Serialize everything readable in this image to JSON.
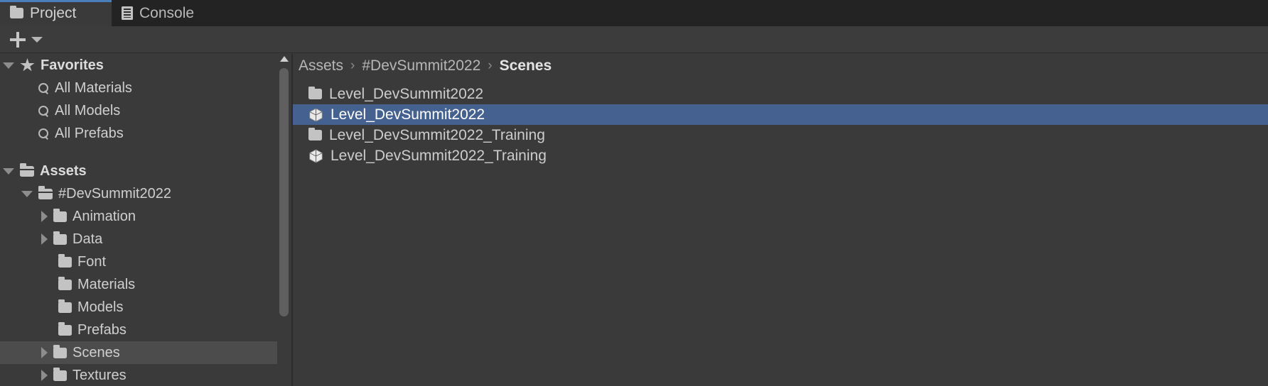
{
  "window": {
    "background": "#3a3a3a",
    "accent_blue": "#4a7ebb",
    "selection_blue": "#44618f",
    "row_highlight": "#4c4c4c"
  },
  "tabs": [
    {
      "label": "Project",
      "icon": "folder-icon",
      "active": true
    },
    {
      "label": "Console",
      "icon": "console-icon",
      "active": false
    }
  ],
  "toolbar": {
    "add_label": "+",
    "add_icon": "plus-icon",
    "dropdown_icon": "caret-down-icon",
    "search": {
      "icon": "search-icon",
      "value": "",
      "placeholder": ""
    }
  },
  "sidebar": {
    "sections": [
      {
        "name": "favorites",
        "header": {
          "label": "Favorites",
          "icon": "star-icon",
          "expanded": true
        },
        "items": [
          {
            "label": "All Materials",
            "icon": "search-icon",
            "indent": 1
          },
          {
            "label": "All Models",
            "icon": "search-icon",
            "indent": 1
          },
          {
            "label": "All Prefabs",
            "icon": "search-icon",
            "indent": 1
          }
        ]
      },
      {
        "name": "assets",
        "header": {
          "label": "Assets",
          "icon": "folder-open-icon",
          "expanded": true
        },
        "items": [
          {
            "label": "#DevSummit2022",
            "icon": "folder-open-icon",
            "indent": 1,
            "expanded": true,
            "twisty": "down"
          },
          {
            "label": "Animation",
            "icon": "folder-icon",
            "indent": 2,
            "twisty": "right"
          },
          {
            "label": "Data",
            "icon": "folder-icon",
            "indent": 2,
            "twisty": "right"
          },
          {
            "label": "Font",
            "icon": "folder-icon",
            "indent": 2,
            "twisty": "none"
          },
          {
            "label": "Materials",
            "icon": "folder-icon",
            "indent": 2,
            "twisty": "none"
          },
          {
            "label": "Models",
            "icon": "folder-icon",
            "indent": 2,
            "twisty": "none"
          },
          {
            "label": "Prefabs",
            "icon": "folder-icon",
            "indent": 2,
            "twisty": "none"
          },
          {
            "label": "Scenes",
            "icon": "folder-icon",
            "indent": 2,
            "twisty": "right",
            "selected": true
          },
          {
            "label": "Textures",
            "icon": "folder-icon",
            "indent": 2,
            "twisty": "right"
          }
        ]
      }
    ],
    "scrollbar": {
      "up_icon": "scroll-up-arrow-icon"
    }
  },
  "breadcrumb": {
    "separator": "›",
    "parts": [
      {
        "label": "Assets",
        "current": false
      },
      {
        "label": "#DevSummit2022",
        "current": false
      },
      {
        "label": "Scenes",
        "current": true
      }
    ]
  },
  "files": [
    {
      "label": "Level_DevSummit2022",
      "icon": "folder-icon",
      "selected": false
    },
    {
      "label": "Level_DevSummit2022",
      "icon": "unity-scene-icon",
      "selected": true
    },
    {
      "label": "Level_DevSummit2022_Training",
      "icon": "folder-icon",
      "selected": false
    },
    {
      "label": "Level_DevSummit2022_Training",
      "icon": "unity-scene-icon",
      "selected": false
    }
  ]
}
